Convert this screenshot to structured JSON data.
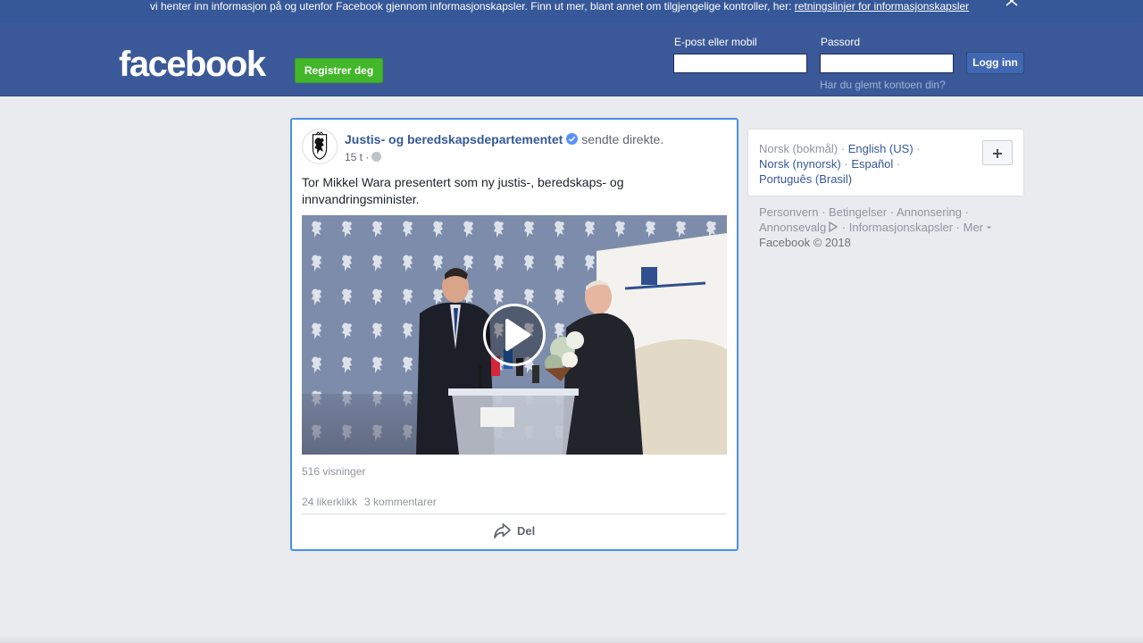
{
  "cookie_banner": {
    "text": "vi henter inn informasjon på og utenfor Facebook gjennom informasjonskapsler. Finn ut mer, blant annet om tilgjengelige kontroller, her: ",
    "link": "retningslinjer for informasjonskapsler"
  },
  "header": {
    "logo": "facebook",
    "register_label": "Registrer deg",
    "email_label": "E-post eller mobil",
    "email_value": "",
    "password_label": "Passord",
    "password_value": "",
    "login_label": "Logg inn",
    "forgot_label": "Har du glemt kontoen din?"
  },
  "post": {
    "author": "Justis- og beredskapsdepartementet",
    "action": "sendte direkte.",
    "time": "15 t ·",
    "text": "Tor Mikkel Wara presentert som ny justis-, beredskaps- og innvandringsminister.",
    "views": "516 visninger",
    "likes": "24 likerklikk",
    "comments": "3 kommentarer",
    "share_label": "Del"
  },
  "languages": {
    "current": "Norsk (bokmål)",
    "items": [
      "English (US)",
      "Norsk (nynorsk)",
      "Español",
      "Português (Brasil)"
    ],
    "separator": " · "
  },
  "footer": {
    "links": [
      "Personvern",
      "Betingelser",
      "Annonsering",
      "Annonsevalg",
      "Informasjonskapsler",
      "Mer"
    ],
    "copyright": "Facebook © 2018"
  },
  "colors": {
    "brand": "#3b5998",
    "register_green": "#42b72a",
    "link": "#365899",
    "focus_border": "#4a90e2"
  }
}
